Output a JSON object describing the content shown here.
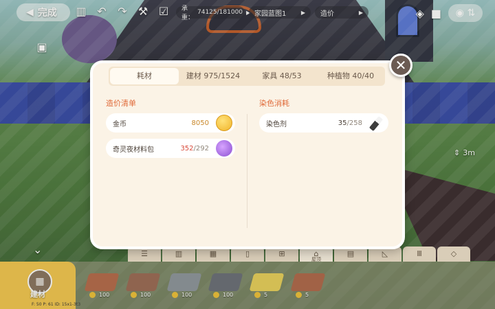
{
  "hud": {
    "done_label": "完成",
    "capacity_label": "承重：",
    "capacity_value": "74125/181000",
    "blueprint_name": "家园蓝图1",
    "cost_label": "造价",
    "distance": "3m"
  },
  "categories": [
    {
      "icon": "list-icon"
    },
    {
      "icon": "fence-icon"
    },
    {
      "icon": "brick-icon"
    },
    {
      "icon": "door-icon"
    },
    {
      "icon": "window-icon"
    },
    {
      "icon": "roof-icon",
      "label": "屋顶",
      "active": true
    },
    {
      "icon": "column-icon"
    },
    {
      "icon": "stairs-icon"
    },
    {
      "icon": "pillar-icon"
    },
    {
      "icon": "shapes-icon"
    }
  ],
  "build_tab": {
    "label": "建材"
  },
  "debug_text": "F: 50   P: 61   ID: 15x1-3t3",
  "tray_items": [
    {
      "count": "100",
      "color": "#b56a4a"
    },
    {
      "count": "100",
      "color": "#9b6a55"
    },
    {
      "count": "100",
      "color": "#8e969c"
    },
    {
      "count": "100",
      "color": "#6a6f78"
    },
    {
      "count": "5",
      "color": "#e9d15a"
    },
    {
      "count": "5",
      "color": "#b0684a"
    }
  ],
  "modal": {
    "tabs": [
      {
        "label": "耗材",
        "active": true
      },
      {
        "label": "建材 975/1524"
      },
      {
        "label": "家具 48/53"
      },
      {
        "label": "种植物 40/40"
      }
    ],
    "left_title": "造价清单",
    "right_title": "染色消耗",
    "left_rows": [
      {
        "name": "金币",
        "have": "8050",
        "need": "",
        "icon": "coin-icon",
        "short": false
      },
      {
        "name": "奇灵夜材料包",
        "have": "352",
        "need": "/292",
        "icon": "material-bag-icon",
        "short": true
      }
    ],
    "right_rows": [
      {
        "name": "染色剂",
        "have": "35",
        "need": "/258",
        "icon": "dye-tube-icon",
        "short": false
      }
    ]
  },
  "colors": {
    "accent_orange": "#e06b3a",
    "shortage_red": "#d84a3a",
    "panel_bg": "#fbf3e6",
    "tab_bar_bg": "#f3e4cd"
  }
}
